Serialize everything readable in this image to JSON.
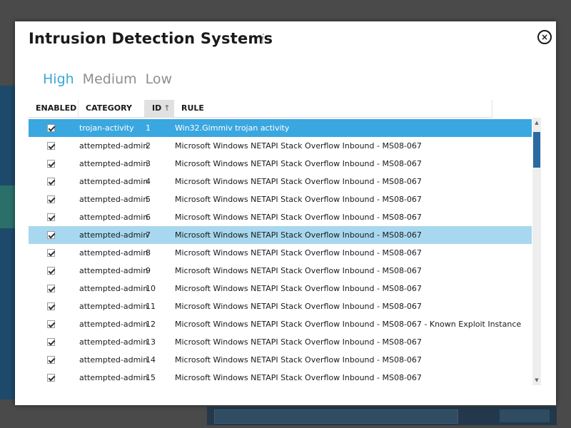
{
  "dialog": {
    "title": "Intrusion Detection Systems",
    "info_icon": "i",
    "close_icon": "×"
  },
  "tabs": [
    {
      "label": "High",
      "active": true
    },
    {
      "label": "Medium",
      "active": false
    },
    {
      "label": "Low",
      "active": false
    }
  ],
  "table": {
    "columns": {
      "enabled": "ENABLED",
      "category": "CATEGORY",
      "id": "ID",
      "rule": "RULE"
    },
    "sort_indicator": "↑",
    "rows": [
      {
        "enabled": true,
        "category": "trojan-activity",
        "id": "1",
        "rule": "Win32.Gimmiv trojan activity"
      },
      {
        "enabled": true,
        "category": "attempted-admin",
        "id": "2",
        "rule": "Microsoft Windows NETAPI Stack Overflow Inbound - MS08-067"
      },
      {
        "enabled": true,
        "category": "attempted-admin",
        "id": "3",
        "rule": "Microsoft Windows NETAPI Stack Overflow Inbound - MS08-067"
      },
      {
        "enabled": true,
        "category": "attempted-admin",
        "id": "4",
        "rule": "Microsoft Windows NETAPI Stack Overflow Inbound - MS08-067"
      },
      {
        "enabled": true,
        "category": "attempted-admin",
        "id": "5",
        "rule": "Microsoft Windows NETAPI Stack Overflow Inbound - MS08-067"
      },
      {
        "enabled": true,
        "category": "attempted-admin",
        "id": "6",
        "rule": "Microsoft Windows NETAPI Stack Overflow Inbound - MS08-067"
      },
      {
        "enabled": true,
        "category": "attempted-admin",
        "id": "7",
        "rule": "Microsoft Windows NETAPI Stack Overflow Inbound - MS08-067"
      },
      {
        "enabled": true,
        "category": "attempted-admin",
        "id": "8",
        "rule": "Microsoft Windows NETAPI Stack Overflow Inbound - MS08-067"
      },
      {
        "enabled": true,
        "category": "attempted-admin",
        "id": "9",
        "rule": "Microsoft Windows NETAPI Stack Overflow Inbound - MS08-067"
      },
      {
        "enabled": true,
        "category": "attempted-admin",
        "id": "10",
        "rule": "Microsoft Windows NETAPI Stack Overflow Inbound - MS08-067"
      },
      {
        "enabled": true,
        "category": "attempted-admin",
        "id": "11",
        "rule": "Microsoft Windows NETAPI Stack Overflow Inbound - MS08-067"
      },
      {
        "enabled": true,
        "category": "attempted-admin",
        "id": "12",
        "rule": "Microsoft Windows NETAPI Stack Overflow Inbound - MS08-067 - Known Exploit Instance"
      },
      {
        "enabled": true,
        "category": "attempted-admin",
        "id": "13",
        "rule": "Microsoft Windows NETAPI Stack Overflow Inbound - MS08-067"
      },
      {
        "enabled": true,
        "category": "attempted-admin",
        "id": "14",
        "rule": "Microsoft Windows NETAPI Stack Overflow Inbound - MS08-067"
      },
      {
        "enabled": true,
        "category": "attempted-admin",
        "id": "15",
        "rule": "Microsoft Windows NETAPI Stack Overflow Inbound - MS08-067"
      }
    ],
    "selected_row": 0,
    "hover_row": 6
  },
  "colors": {
    "accent": "#3aa7d6",
    "selected_row": "#3aa7e0",
    "hover_row": "#a8d8ef"
  }
}
